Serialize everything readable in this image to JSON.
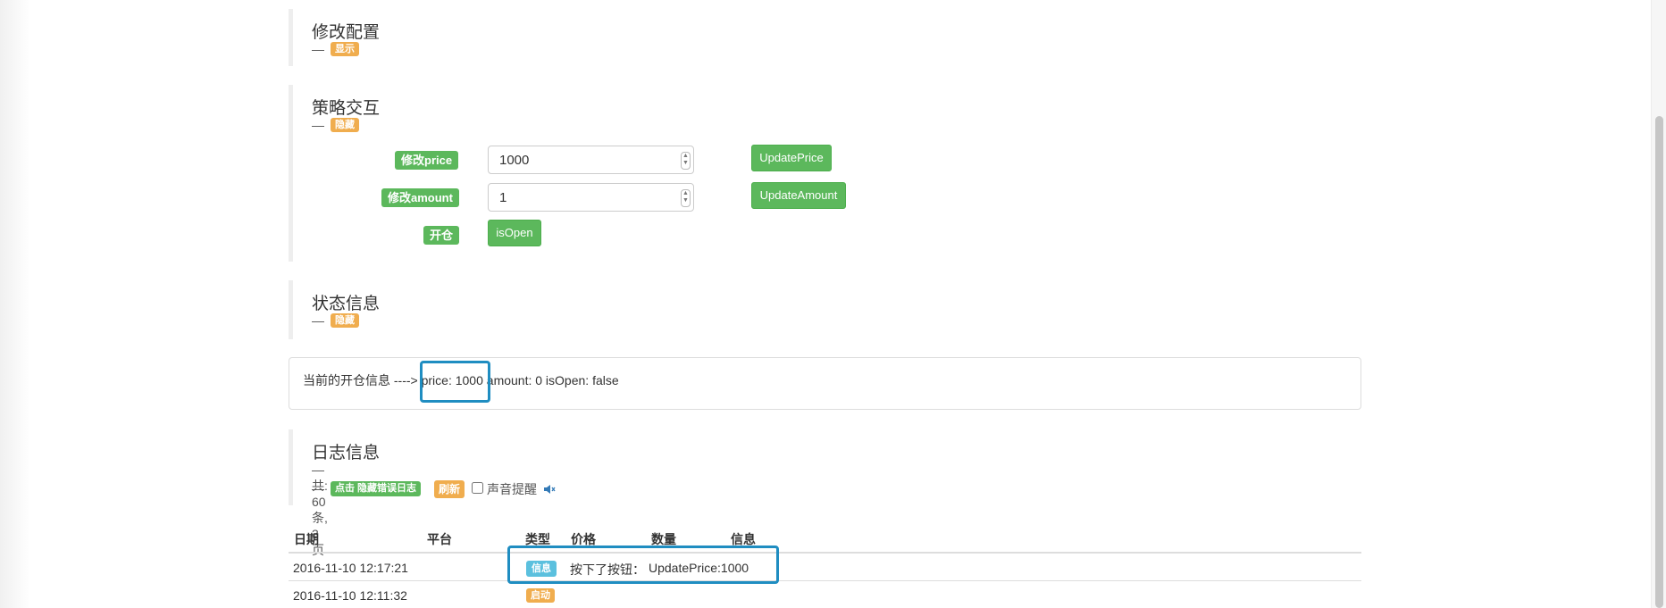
{
  "config": {
    "title": "修改配置",
    "dash": "—",
    "toggle": "显示"
  },
  "interaction": {
    "title": "策略交互",
    "dash": "—",
    "toggle": "隐藏",
    "rows": [
      {
        "label": "修改price",
        "value": "1000",
        "button": "UpdatePrice"
      },
      {
        "label": "修改amount",
        "value": "1",
        "button": "UpdateAmount"
      },
      {
        "label": "开仓",
        "button": "isOpen"
      }
    ]
  },
  "status": {
    "title": "状态信息",
    "dash": "—",
    "toggle": "隐藏",
    "prefix": "当前的开仓信息 ---->",
    "price": "price: 1000",
    "rest": "amount: 0 isOpen: false"
  },
  "log": {
    "title": "日志信息",
    "dash": "—",
    "count_text": "共: 60 条, 3 页",
    "hide_errors_button": "点击 隐藏错误日志",
    "refresh_button": "刷新",
    "sound_label": "声音提醒",
    "sound_icon": "speaker-muted-icon",
    "columns": [
      "日期",
      "平台",
      "类型",
      "价格",
      "数量",
      "信息"
    ],
    "rows": [
      {
        "date": "2016-11-10 12:17:21",
        "platform": "",
        "type": "信息",
        "type_color": "#5bc0de",
        "price": "按下了按钮：",
        "amount": "UpdatePrice:1000",
        "info": ""
      },
      {
        "date": "2016-11-10 12:11:32",
        "platform": "",
        "type": "启动",
        "type_color": "#f0ad4e",
        "price": "",
        "amount": "",
        "info": ""
      }
    ]
  },
  "colors": {
    "accent_green": "#5cb85c",
    "accent_orange": "#f0ad4e",
    "accent_info": "#5bc0de",
    "highlight": "#1f8dc1"
  }
}
